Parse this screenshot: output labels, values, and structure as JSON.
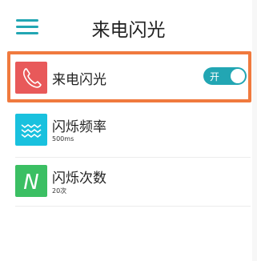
{
  "header": {
    "title": "来电闪光"
  },
  "settings": [
    {
      "label": "来电闪光",
      "toggle": {
        "text": "开",
        "on": true
      }
    },
    {
      "label": "闪烁频率",
      "value": "500ms"
    },
    {
      "label": "闪烁次数",
      "value": "20次",
      "icon_letter": "N"
    }
  ],
  "colors": {
    "accent": "#22a6b3",
    "highlight": "#f07a3e",
    "icon_call": "#e8595a",
    "icon_frequency": "#19c1de",
    "icon_count": "#3bbf63"
  },
  "icons": {
    "menu": "hamburger-icon",
    "call": "phone-icon",
    "frequency": "wave-icon",
    "count": "letter-n-icon"
  }
}
